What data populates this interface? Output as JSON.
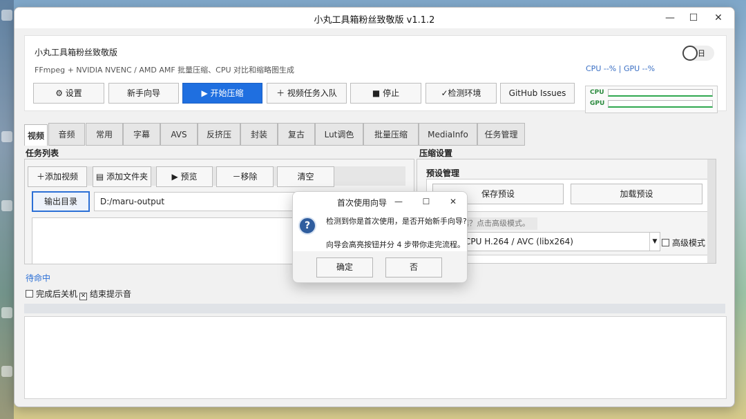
{
  "window": {
    "title": "小丸工具箱粉丝致敬版 v1.1.2",
    "minimize": "—",
    "maximize": "☐",
    "close": "✕"
  },
  "header": {
    "app_name": "小丸工具箱粉丝致敬版",
    "subtitle": "FFmpeg + NVIDIA NVENC / AMD AMF 批量压缩、CPU 对比和缩略图生成",
    "theme_toggle_label": "日",
    "stats": "CPU --%  |  GPU --%",
    "monitor_cpu_label": "CPU",
    "monitor_gpu_label": "GPU",
    "colors": {
      "primary": "#1f6fe0",
      "accent_text": "#3a6fc4",
      "monitor_green": "#2fa84f"
    }
  },
  "toolbar": {
    "settings": "⚙ 设置",
    "wizard": "新手向导",
    "start": "▶ 开始压缩",
    "enqueue": "＋ 视频任务入队",
    "stop": "■ 停止",
    "check_env": "✓检测环境",
    "github": "GitHub Issues"
  },
  "tabs": [
    "视频",
    "音频",
    "常用",
    "字幕",
    "AVS",
    "反挤压",
    "封装",
    "复古",
    "Lut调色",
    "批量压缩",
    "MediaInfo",
    "任务管理"
  ],
  "task": {
    "title": "任务列表",
    "add_video": "＋添加视频",
    "add_folder": "▤ 添加文件夹",
    "preview": "▶ 预览",
    "remove": "－移除",
    "clear": "清空",
    "output_dir_button": "输出目录",
    "output_dir_value": "D:/maru-output"
  },
  "compress": {
    "title": "压缩设置",
    "preset_title": "预设管理",
    "save_preset": "保存预设",
    "load_preset": "加载预设",
    "hint_partial": "器？点击高级模式。",
    "encoder_value": "CPU H.264 / AVC (libx264)",
    "advanced_mode": "高级模式"
  },
  "status": {
    "text": "待命中",
    "shutdown_after": "完成后关机",
    "play_sound": "结束提示音",
    "shutdown_checked": false,
    "sound_checked": true
  },
  "dialog": {
    "title": "首次使用向导",
    "icon": "question-icon",
    "message_line1": "检测到你是首次使用，是否开始新手向导?",
    "message_line2": "向导会高亮按钮并分 4 步带你走完流程。",
    "ok": "确定",
    "no": "否"
  }
}
